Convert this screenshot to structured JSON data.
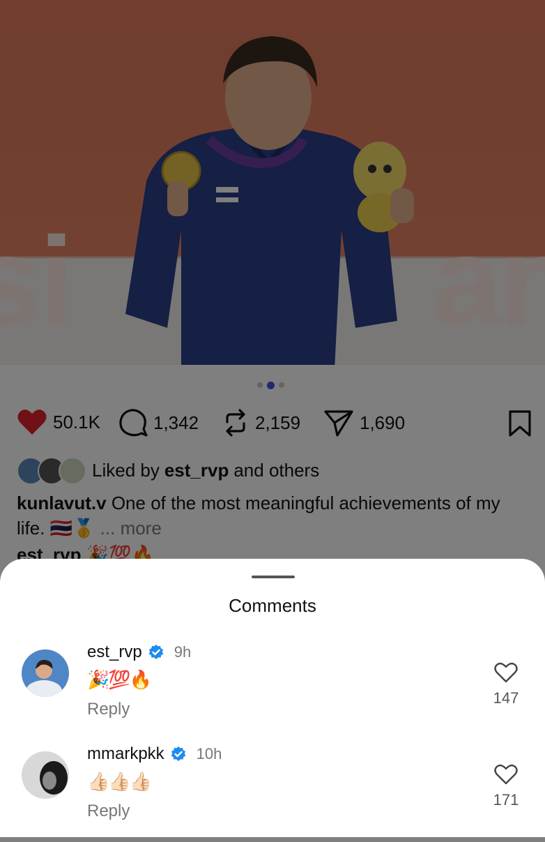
{
  "post": {
    "image_banner_left": "si",
    "image_banner_right": "am",
    "carousel": {
      "count": 3,
      "active_index": 1
    },
    "likes_count": "50.1K",
    "comments_count": "1,342",
    "reposts_count": "2,159",
    "shares_count": "1,690",
    "liked_by_prefix": "Liked by",
    "liked_by_user": "est_rvp",
    "liked_by_suffix": "and others",
    "caption_user": "kunlavut.v",
    "caption_text": "One of the most meaningful achievements of my life. 🇹🇭🥇",
    "caption_more": "... more",
    "preview_comment_user": "est_rvp",
    "preview_comment_text": "🎉💯🔥"
  },
  "sheet": {
    "title": "Comments",
    "comments": [
      {
        "user": "est_rvp",
        "time": "9h",
        "text": "🎉💯🔥",
        "reply": "Reply",
        "likes": "147",
        "verified": true
      },
      {
        "user": "mmarkpkk",
        "time": "10h",
        "text": "👍🏻👍🏻👍🏻",
        "reply": "Reply",
        "likes": "171",
        "verified": true
      }
    ]
  },
  "colors": {
    "like_red": "#e0202f",
    "verified_blue": "#1d8cf0",
    "carousel_active": "#3b55e6",
    "photo_background": "#e07a5c",
    "jacket": "#2c3f88"
  }
}
